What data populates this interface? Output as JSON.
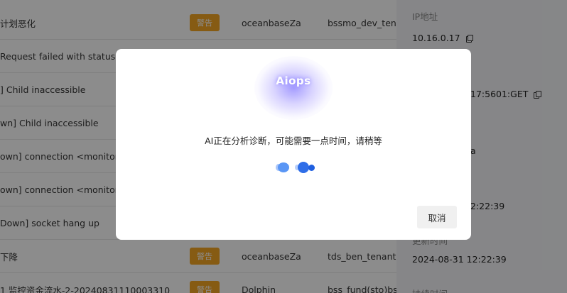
{
  "table": {
    "rows": [
      {
        "title": "计划恶化",
        "badge": "警告",
        "source": "oceanbaseZa",
        "tenant": "bssmo_dev_tenant"
      },
      {
        "title": "Request failed with status co",
        "badge": "",
        "source": "",
        "tenant": ""
      },
      {
        "title": "] Child inaccessible",
        "badge": "",
        "source": "",
        "tenant": ""
      },
      {
        "title": "wn] Child inaccessible",
        "badge": "",
        "source": "",
        "tenant": ""
      },
      {
        "title": "own] connection <monitor>",
        "badge": "",
        "source": "",
        "tenant": ""
      },
      {
        "title": "own] connection <monitor>",
        "badge": "",
        "source": "",
        "tenant": ""
      },
      {
        "title": "Down] socket hang up",
        "badge": "",
        "source": "",
        "tenant": ""
      },
      {
        "title": "下降",
        "badge": "警告",
        "source": "oceanbaseZa",
        "tenant": "tds_ben_tenant"
      },
      {
        "title": "1 监控资金流水-2-20240831110003310",
        "badge": "警告",
        "source": "Dolphin",
        "tenant": "bss_fund(sto)bss"
      }
    ]
  },
  "detail": {
    "ip_label": "IP地址",
    "ip_value": "10.16.0.17",
    "endpoint_value": "17:5601:GET",
    "field_partial": "a",
    "time1_value": "2:22:39",
    "update_label": "更新时间",
    "update_value": "2024-08-31 12:22:39",
    "duration_label": "持续时间"
  },
  "modal": {
    "logo_text": "Aiops",
    "message": "AI正在分析诊断，可能需要一点时间，请稍等",
    "cancel_label": "取消"
  },
  "colors": {
    "badge_bg": "#f5a623",
    "loader_primary": "#2f6ee8",
    "logo_glow": "#968cff"
  }
}
